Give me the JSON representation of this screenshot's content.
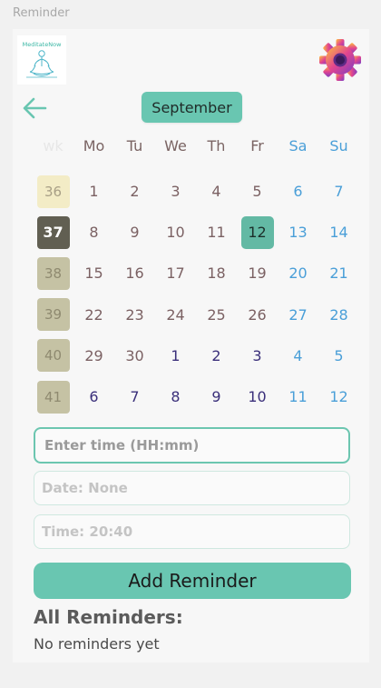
{
  "window": {
    "title": "Reminder"
  },
  "logo": {
    "text": "MeditateNow"
  },
  "calendar": {
    "month": "September",
    "weekday_headers": [
      "Mo",
      "Tu",
      "We",
      "Th",
      "Fr",
      "Sa",
      "Su"
    ],
    "weeks": [
      {
        "week": "36",
        "days": [
          "1",
          "2",
          "3",
          "4",
          "5",
          "6",
          "7"
        ]
      },
      {
        "week": "37",
        "days": [
          "8",
          "9",
          "10",
          "11",
          "12",
          "13",
          "14"
        ]
      },
      {
        "week": "38",
        "days": [
          "15",
          "16",
          "17",
          "18",
          "19",
          "20",
          "21"
        ]
      },
      {
        "week": "39",
        "days": [
          "22",
          "23",
          "24",
          "25",
          "26",
          "27",
          "28"
        ]
      },
      {
        "week": "40",
        "days": [
          "29",
          "30",
          "1",
          "2",
          "3",
          "4",
          "5"
        ]
      },
      {
        "week": "41",
        "days": [
          "6",
          "7",
          "8",
          "9",
          "10",
          "11",
          "12"
        ]
      }
    ],
    "selected_day": "12",
    "current_week": "37"
  },
  "form": {
    "time_input_placeholder": "Enter time (HH:mm)",
    "date_label": "Date: None",
    "time_label": "Time: 20:40",
    "add_button": "Add Reminder"
  },
  "reminders": {
    "title": "All Reminders:",
    "empty_text": "No reminders yet"
  },
  "colors": {
    "accent": "#69c6b1",
    "weekend": "#4a9fd8",
    "current_week": "#615f52"
  }
}
